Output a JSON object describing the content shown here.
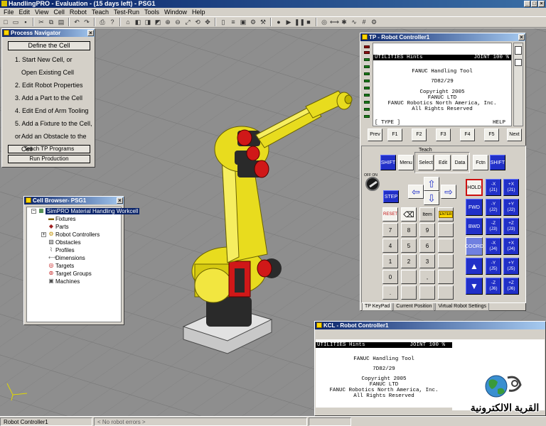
{
  "app": {
    "title": "HandlingPRO - Evaluation - (15 days left) - PSG1"
  },
  "menu": [
    "File",
    "Edit",
    "View",
    "Cell",
    "Robot",
    "Teach",
    "Test-Run",
    "Tools",
    "Window",
    "Help"
  ],
  "process_navigator": {
    "title": "Process Navigator",
    "define_cell": "Define the Cell",
    "steps": [
      "1.  Start New Cell, or",
      "Open Existing Cell",
      "2.  Edit Robot Properties",
      "3.  Add a Part to the Cell",
      "4.  Edit End of Arm Tooling",
      "5.  Add a Fixture to the Cell, or",
      "Add an Obstacle to the Cell"
    ],
    "teach_tp": "Teach TP Programs",
    "run_production": "Run Production"
  },
  "cell_browser": {
    "title": "Cell Browser- PSG1",
    "root": "SimPRO Material Handling Workcell",
    "items": [
      "Fixtures",
      "Parts",
      "Robot Controllers",
      "Obstacles",
      "Profiles",
      "Dimensions",
      "Targets",
      "Target Groups",
      "Machines"
    ]
  },
  "tp": {
    "title": "TP - Robot Controller1",
    "hint_bar": "UTILITIES Hints                JOINT 100 %",
    "lines": [
      "FANUC Handling Tool",
      "7D82/29",
      "Copyright 2005",
      "FANUC LTD",
      "FANUC Robotics North America, Inc.",
      "All Rights Reserved"
    ],
    "type_label": "[ TYPE ]",
    "help_label": "HELP",
    "fkeys": [
      "Prev",
      "F1",
      "F2",
      "F3",
      "F4",
      "F5",
      "Next"
    ],
    "teach_label": "Teach",
    "shift": "SHIFT",
    "menu": "Menu",
    "select": "Select",
    "edit": "Edit",
    "data": "Data",
    "fctn": "Fctn",
    "offon": "OFF  ON",
    "step": "STEP",
    "reset": "RESET",
    "item": "Item",
    "enter": "ENTER",
    "hold": "HOLD",
    "fwd": "FWD",
    "bwd": "BWD",
    "coord": "COORD",
    "numkeys": [
      "7",
      "8",
      "9",
      "4",
      "5",
      "6",
      "1",
      "2",
      "3",
      "0",
      ".",
      ","
    ],
    "jog_neg": [
      "-X\n(J1)",
      "-Y\n(J2)",
      "-Z\n(J3)",
      "-X\n(J4)",
      "-Y\n(J5)",
      "-Z\n(J6)"
    ],
    "jog_pos": [
      "+X\n(J1)",
      "+Y\n(J2)",
      "+Z\n(J3)",
      "+X\n(J4)",
      "+Y\n(J5)",
      "+Z\n(J6)"
    ],
    "tabs": [
      "TP KeyPad",
      "Current Position",
      "Virtual Robot Settings"
    ]
  },
  "kcl": {
    "title": "KCL - Robot Controller1",
    "hint_bar": "UTILITIES Hints              JOINT 100 %",
    "lines": [
      "FANUC Handling Tool",
      "7D82/29",
      "Copyright 2005",
      "FANUC LTD",
      "FANUC Robotics North America, Inc.",
      "All Rights Reserved"
    ]
  },
  "status": {
    "controller": "Robot Controller1",
    "errors": "< No robot errors >"
  },
  "watermark": "القرية الالكترونية",
  "colors": {
    "robot_yellow": "#e8dc1e",
    "robot_red": "#d01818",
    "jog_blue": "#2130c8",
    "hold_red": "#cc1010"
  }
}
